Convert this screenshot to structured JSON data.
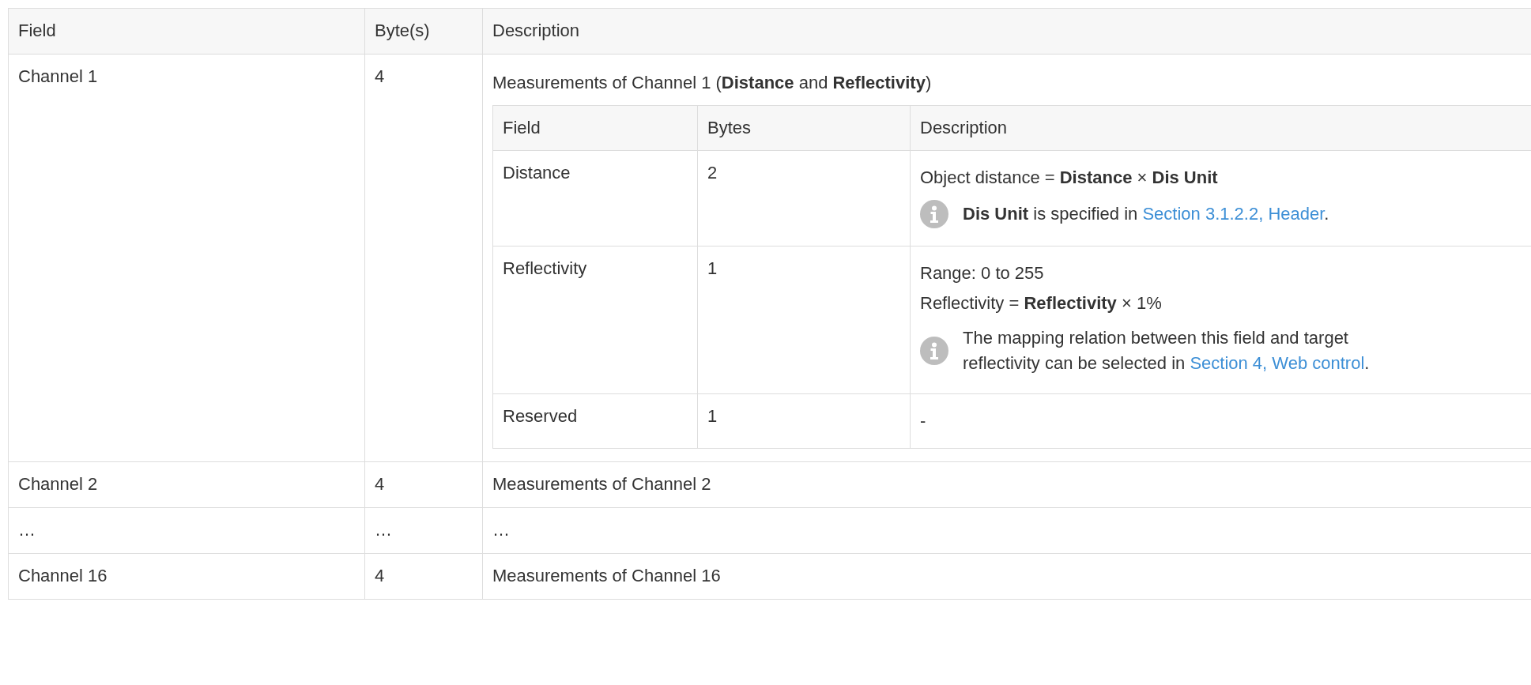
{
  "table": {
    "columns": [
      "Field",
      "Byte(s)",
      "Description"
    ],
    "rows": [
      {
        "field": "Channel 1",
        "bytes": "4",
        "description": "Measurements of Channel 1 (**Distance** and **Reflectivity**)",
        "subtable": {
          "columns": [
            "Field",
            "Bytes",
            "Description"
          ],
          "rows": [
            {
              "field": "Distance",
              "bytes": "2",
              "content": [
                {
                  "kind": "text",
                  "parts": [
                    {
                      "text": "Object distance = **Distance** × **Dis Unit**"
                    }
                  ]
                },
                {
                  "kind": "note",
                  "parts": [
                    {
                      "text": "**Dis Unit** is specified in "
                    },
                    {
                      "link": "Section 3.1.2.2, Header"
                    },
                    {
                      "text": "."
                    }
                  ]
                }
              ]
            },
            {
              "field": "Reflectivity",
              "bytes": "1",
              "content": [
                {
                  "kind": "text",
                  "parts": [
                    {
                      "text": "Range: 0 to 255"
                    }
                  ]
                },
                {
                  "kind": "text",
                  "parts": [
                    {
                      "text": "Reflectivity = **Reflectivity** × 1%"
                    }
                  ]
                },
                {
                  "kind": "note",
                  "parts": [
                    {
                      "text": "The mapping relation between this field and target reflectivity can be selected in "
                    },
                    {
                      "link": "Section 4, Web control"
                    },
                    {
                      "text": "."
                    }
                  ]
                }
              ]
            },
            {
              "field": "Reserved",
              "bytes": "1",
              "content": [
                {
                  "kind": "text",
                  "parts": [
                    {
                      "text": "-"
                    }
                  ]
                }
              ]
            }
          ]
        }
      },
      {
        "field": "Channel 2",
        "bytes": "4",
        "description": "Measurements of Channel 2"
      },
      {
        "field": "…",
        "bytes": "…",
        "description": "…"
      },
      {
        "field": "Channel 16",
        "bytes": "4",
        "description": "Measurements of Channel 16"
      }
    ]
  }
}
